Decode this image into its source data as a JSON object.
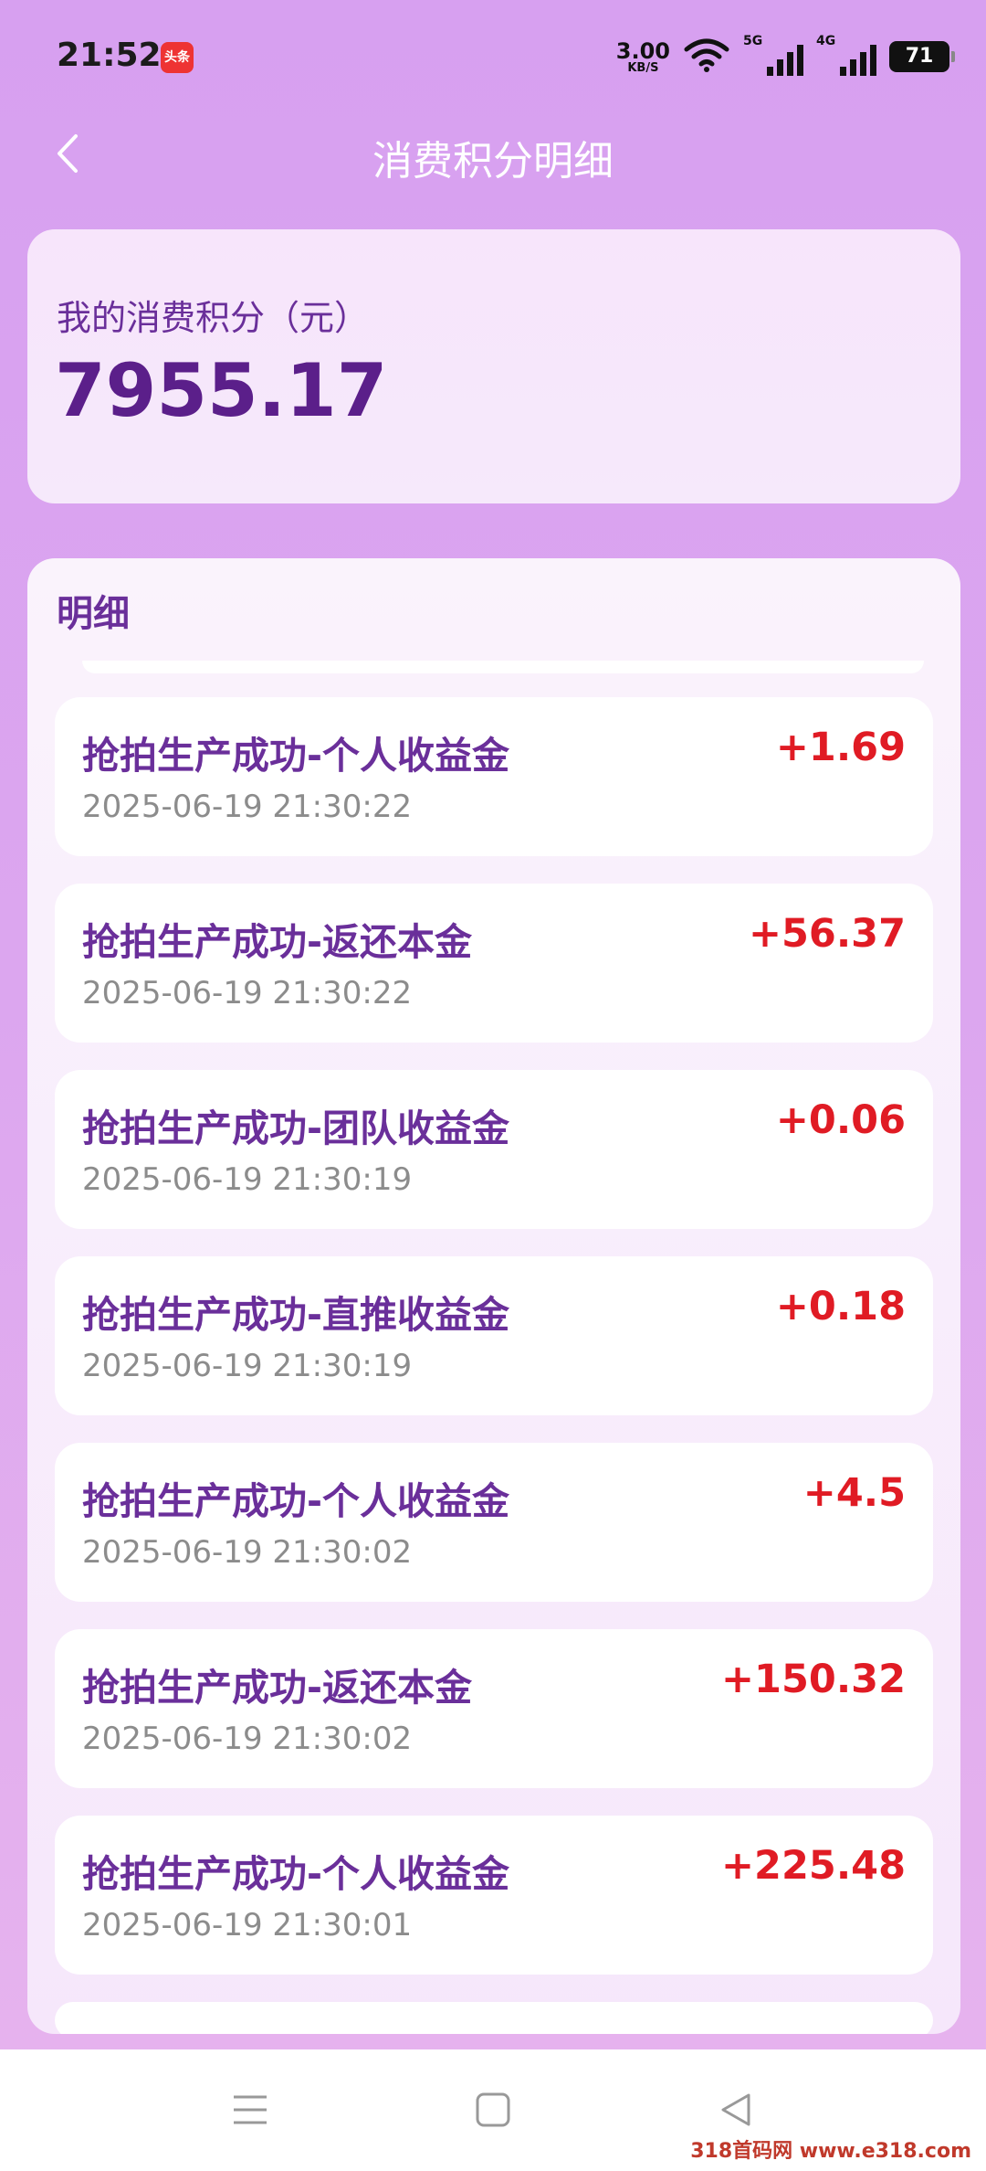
{
  "status_bar": {
    "time": "21:52",
    "app_badge": "头条",
    "net_speed_value": "3.00",
    "net_speed_unit": "KB/S",
    "signal1_label": "5G",
    "signal2_label": "4G",
    "battery": "71"
  },
  "header": {
    "title": "消费积分明细",
    "back_icon": "chevron-left-icon"
  },
  "summary": {
    "label": "我的消费积分（元）",
    "value": "7955.17"
  },
  "detail": {
    "title": "明细",
    "items": [
      {
        "title": "抢拍生产成功-个人收益金",
        "time": "2025-06-19 21:30:22",
        "amount": "+1.69"
      },
      {
        "title": "抢拍生产成功-返还本金",
        "time": "2025-06-19 21:30:22",
        "amount": "+56.37"
      },
      {
        "title": "抢拍生产成功-团队收益金",
        "time": "2025-06-19 21:30:19",
        "amount": "+0.06"
      },
      {
        "title": "抢拍生产成功-直推收益金",
        "time": "2025-06-19 21:30:19",
        "amount": "+0.18"
      },
      {
        "title": "抢拍生产成功-个人收益金",
        "time": "2025-06-19 21:30:02",
        "amount": "+4.5"
      },
      {
        "title": "抢拍生产成功-返还本金",
        "time": "2025-06-19 21:30:02",
        "amount": "+150.32"
      },
      {
        "title": "抢拍生产成功-个人收益金",
        "time": "2025-06-19 21:30:01",
        "amount": "+225.48"
      }
    ]
  },
  "nav_bar": {
    "menu_icon": "menu-icon",
    "home_icon": "home-square-icon",
    "back_icon": "back-triangle-icon"
  },
  "watermark": "318首码网 www.e318.com",
  "colors": {
    "accent_purple": "#6a2f9a",
    "amount_red": "#e01b24",
    "background": "#d7a0f0"
  }
}
